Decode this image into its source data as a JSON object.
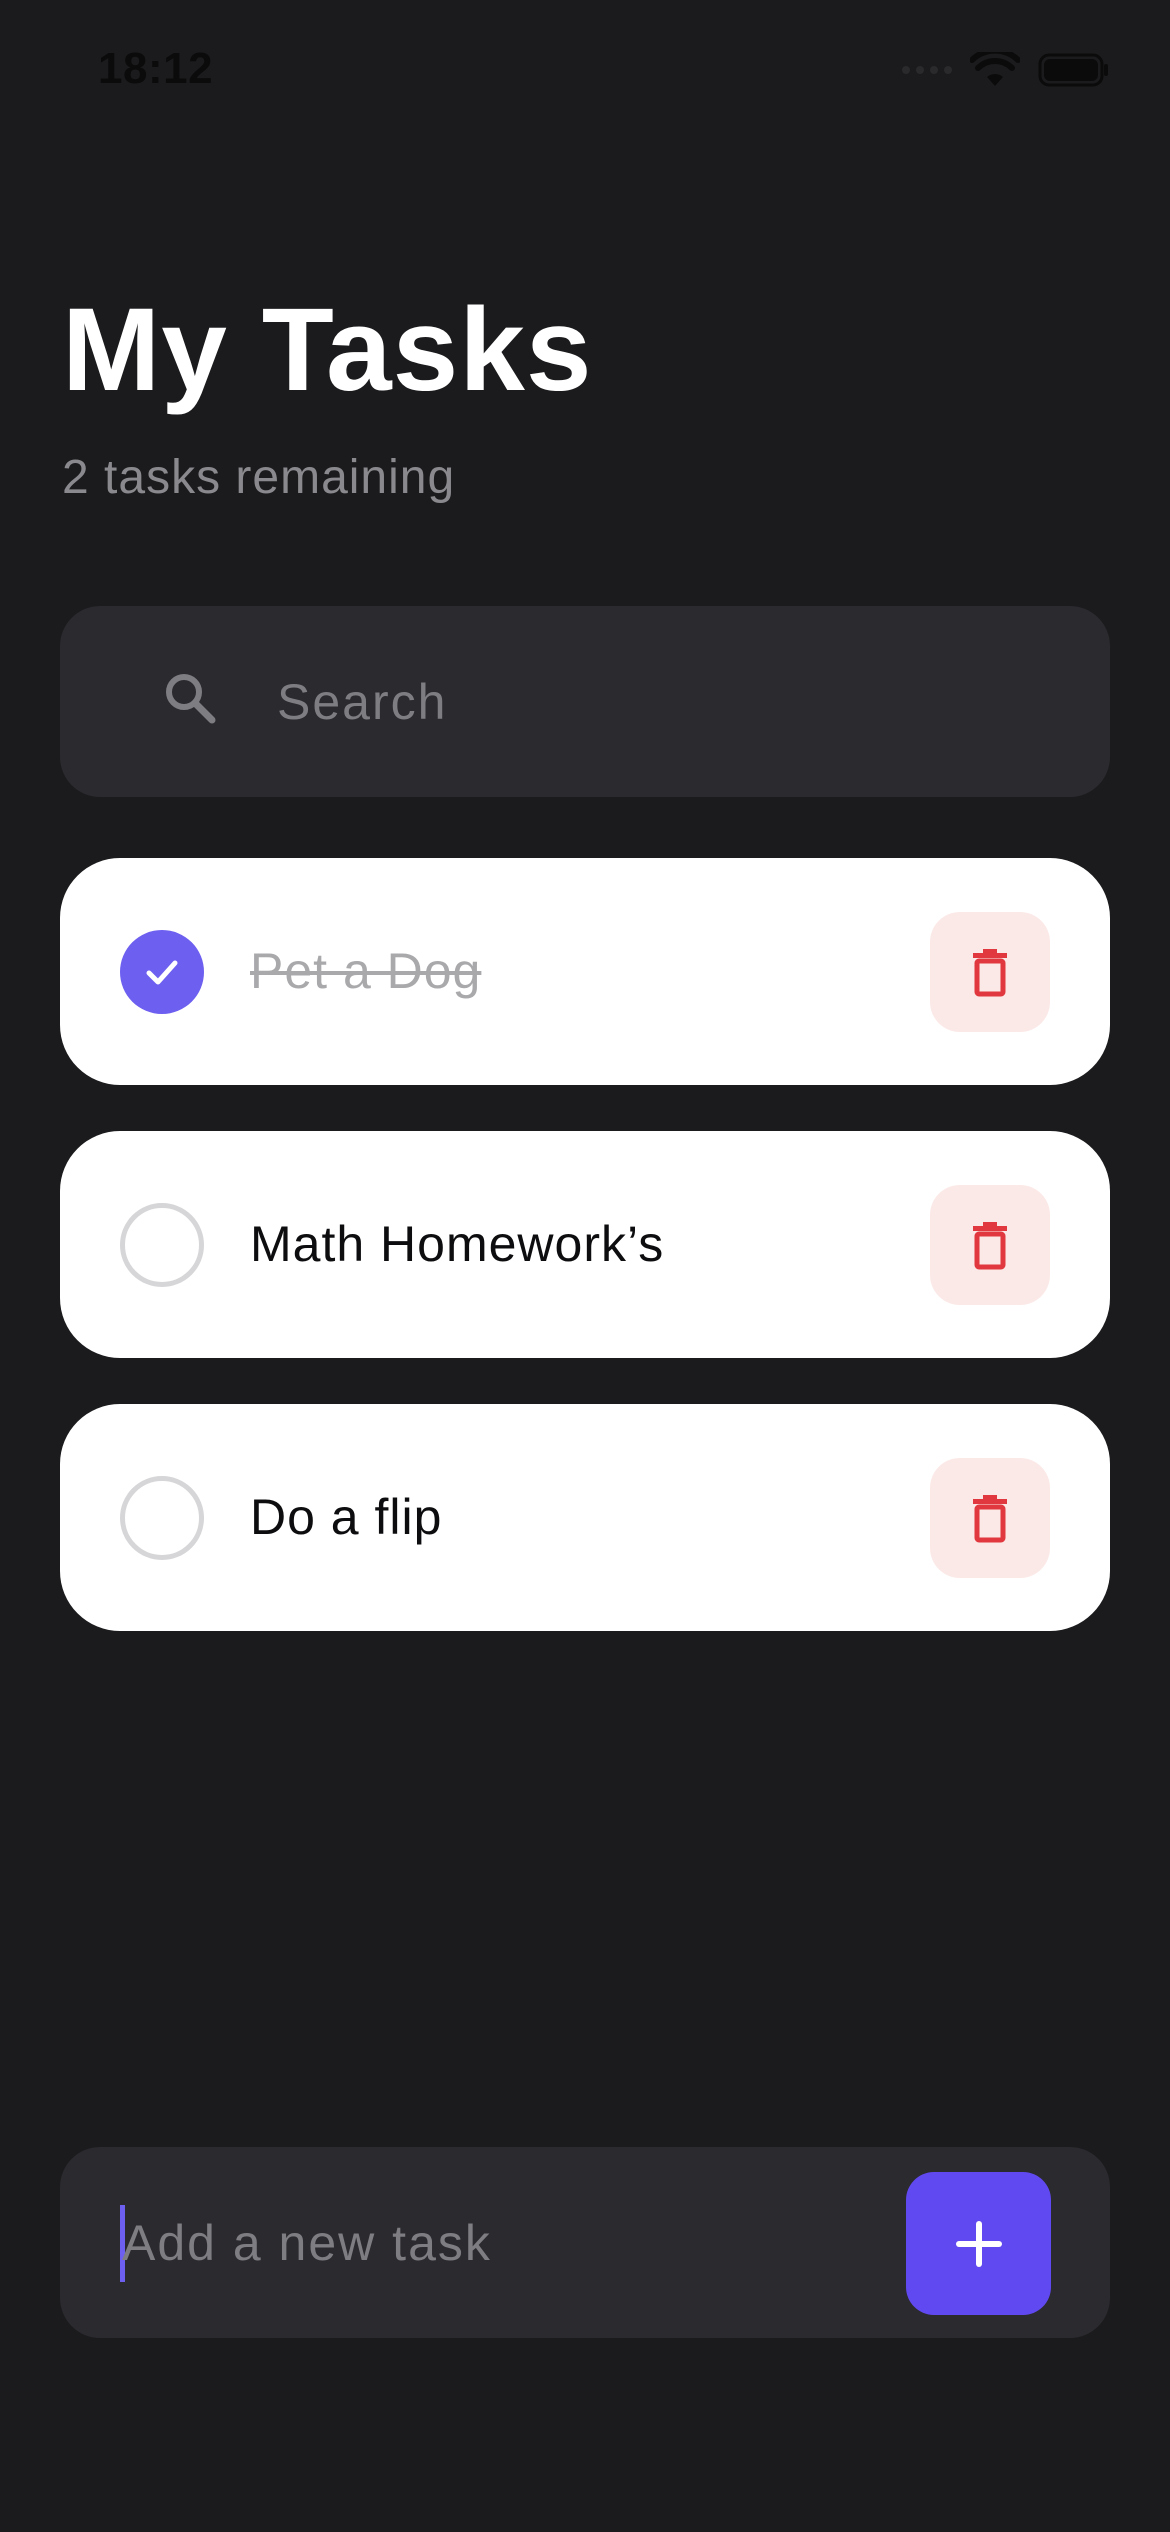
{
  "status_bar": {
    "time": "18:12"
  },
  "header": {
    "title": "My Tasks",
    "subtitle": "2 tasks remaining"
  },
  "search": {
    "placeholder": "Search",
    "icon": "search-icon"
  },
  "tasks": [
    {
      "label": "Pet a Dog",
      "completed": true
    },
    {
      "label": "Math Homework’s",
      "completed": false
    },
    {
      "label": "Do a flip",
      "completed": false
    }
  ],
  "composer": {
    "placeholder": "Add a new task",
    "add_icon": "plus-icon"
  },
  "colors": {
    "background": "#1b1b1d",
    "accent": "#6149f1",
    "checked": "#6d5ff0",
    "delete_icon": "#e0383e",
    "delete_bg": "#fbe9e7"
  }
}
